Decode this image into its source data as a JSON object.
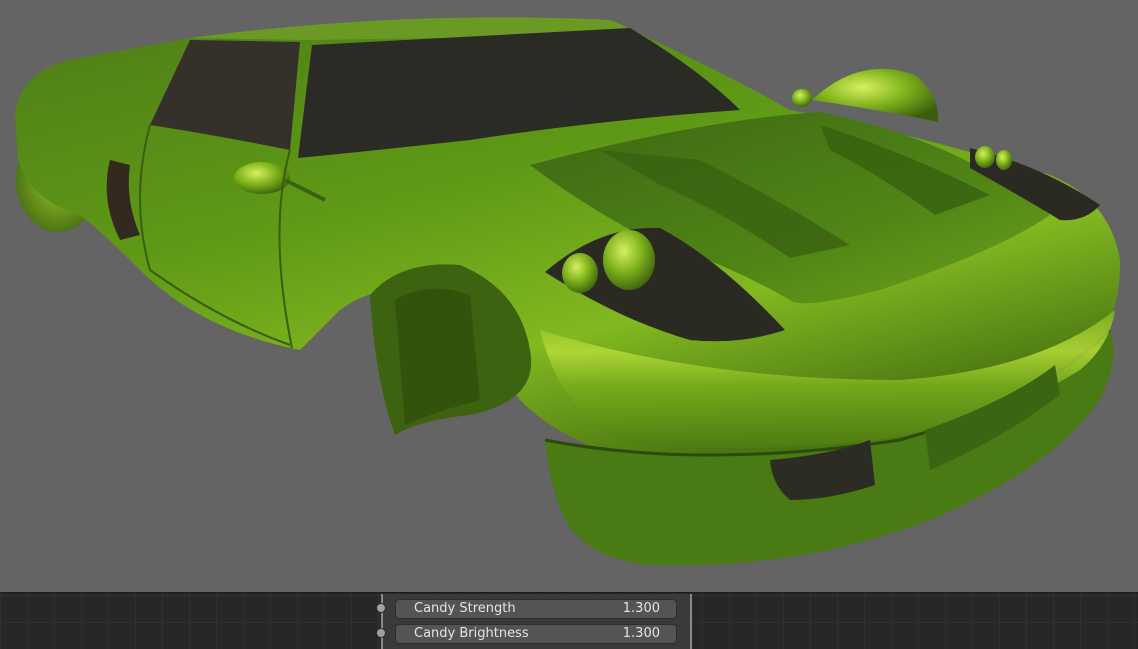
{
  "node_panel": {
    "inputs": [
      {
        "label": "Candy Strength",
        "value": "1.300"
      },
      {
        "label": "Candy Brightness",
        "value": "1.300"
      }
    ]
  },
  "colors": {
    "viewport_bg": "#646464",
    "car_paint": "#5f9a16",
    "car_highlight": "#b4dc3a",
    "glass": "#2b2b25",
    "node_editor_bg": "#272727",
    "field_bg": "#545454"
  }
}
